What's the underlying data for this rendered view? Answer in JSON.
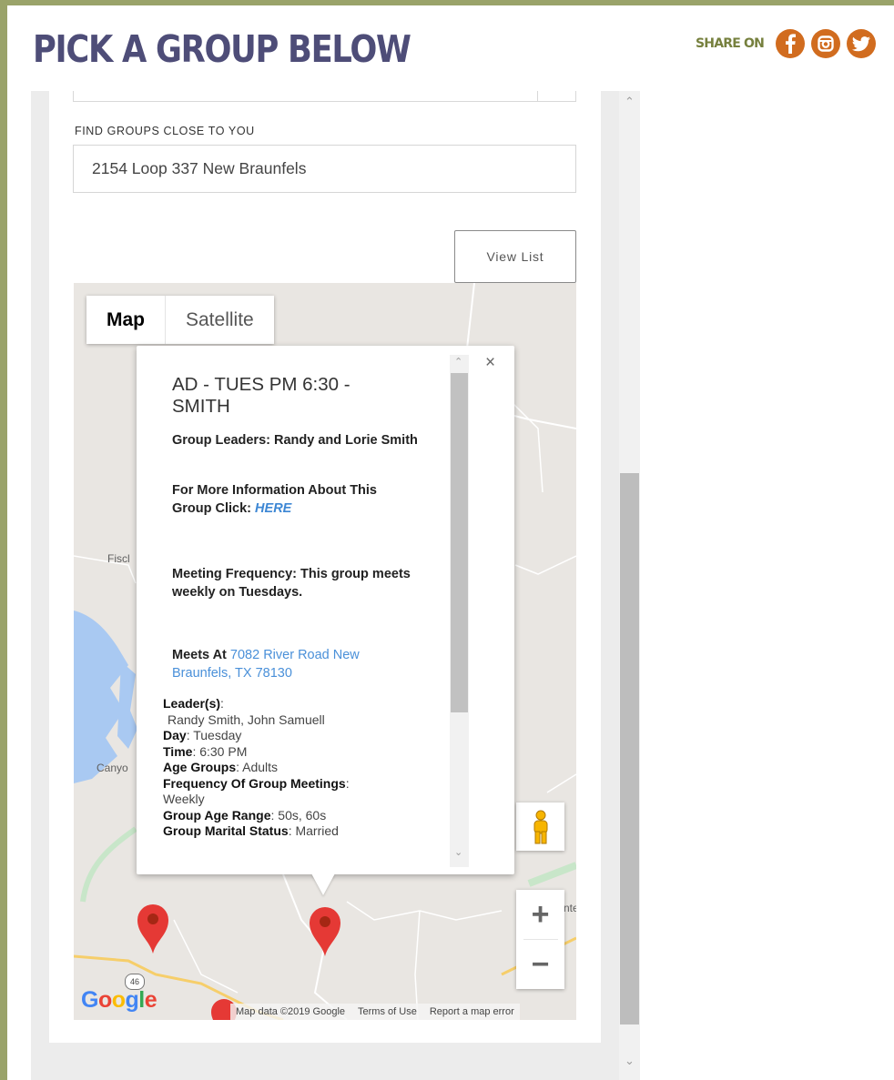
{
  "header": {
    "title": "PICK A GROUP BELOW",
    "share_label": "SHARE ON",
    "social": [
      {
        "icon": "facebook-icon"
      },
      {
        "icon": "instagram-icon"
      },
      {
        "icon": "twitter-icon"
      }
    ]
  },
  "form": {
    "find_label": "FIND GROUPS CLOSE TO YOU",
    "address_value": "2154 Loop 337 New Braunfels",
    "view_list_label": "View List"
  },
  "map": {
    "type_controls": [
      "Map",
      "Satellite"
    ],
    "active_type": "Map",
    "place_labels": [
      "Fiscl",
      "Canyo",
      "nte"
    ],
    "route_number": "46",
    "google_logo": "Google",
    "attribution": [
      "Map data ©2019 Google",
      "Terms of Use",
      "Report a map error"
    ],
    "zoom_in": "+",
    "zoom_out": "−",
    "colors": {
      "pin": "#e53935",
      "water": "#a9c9f2",
      "park": "#c8e6c9"
    }
  },
  "popup": {
    "title": "AD - TUES PM 6:30 - SMITH",
    "leaders_line": "Group Leaders: Randy and Lorie Smith",
    "info_prefix": "For More Information About This Group Click: ",
    "info_link": "HERE",
    "frequency_line": "Meeting Frequency: This group meets weekly on Tuesdays.",
    "meets_label": "Meets At ",
    "meets_address": "7082 River Road New Braunfels, TX 78130",
    "close": "×",
    "details": {
      "leaders_label": "Leader(s)",
      "leaders_value": "Randy Smith,   John Samuell",
      "day_label": "Day",
      "day_value": "Tuesday",
      "time_label": "Time",
      "time_value": "6:30 PM",
      "age_groups_label": "Age Groups",
      "age_groups_value": "Adults",
      "frequency_label": "Frequency Of Group Meetings",
      "frequency_value": "Weekly",
      "age_range_label": "Group Age Range",
      "age_range_value": "50s, 60s",
      "marital_label": "Group Marital Status",
      "marital_value": "Married"
    }
  },
  "theme": {
    "title_color": "#4e4d78",
    "share_color": "#76803e",
    "social_bg": "#d16c1f",
    "border": "#9aa36a"
  }
}
